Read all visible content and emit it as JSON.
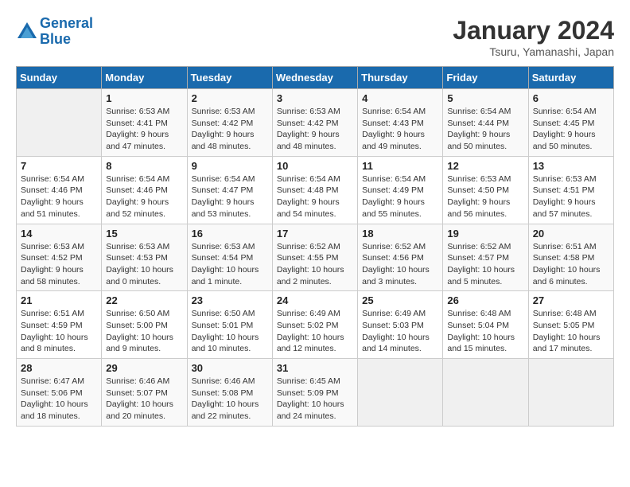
{
  "header": {
    "logo_line1": "General",
    "logo_line2": "Blue",
    "month": "January 2024",
    "location": "Tsuru, Yamanashi, Japan"
  },
  "days_of_week": [
    "Sunday",
    "Monday",
    "Tuesday",
    "Wednesday",
    "Thursday",
    "Friday",
    "Saturday"
  ],
  "weeks": [
    [
      {
        "day": "",
        "sunrise": "",
        "sunset": "",
        "daylight": "",
        "empty": true
      },
      {
        "day": "1",
        "sunrise": "Sunrise: 6:53 AM",
        "sunset": "Sunset: 4:41 PM",
        "daylight": "Daylight: 9 hours and 47 minutes."
      },
      {
        "day": "2",
        "sunrise": "Sunrise: 6:53 AM",
        "sunset": "Sunset: 4:42 PM",
        "daylight": "Daylight: 9 hours and 48 minutes."
      },
      {
        "day": "3",
        "sunrise": "Sunrise: 6:53 AM",
        "sunset": "Sunset: 4:42 PM",
        "daylight": "Daylight: 9 hours and 48 minutes."
      },
      {
        "day": "4",
        "sunrise": "Sunrise: 6:54 AM",
        "sunset": "Sunset: 4:43 PM",
        "daylight": "Daylight: 9 hours and 49 minutes."
      },
      {
        "day": "5",
        "sunrise": "Sunrise: 6:54 AM",
        "sunset": "Sunset: 4:44 PM",
        "daylight": "Daylight: 9 hours and 50 minutes."
      },
      {
        "day": "6",
        "sunrise": "Sunrise: 6:54 AM",
        "sunset": "Sunset: 4:45 PM",
        "daylight": "Daylight: 9 hours and 50 minutes."
      }
    ],
    [
      {
        "day": "7",
        "sunrise": "Sunrise: 6:54 AM",
        "sunset": "Sunset: 4:46 PM",
        "daylight": "Daylight: 9 hours and 51 minutes."
      },
      {
        "day": "8",
        "sunrise": "Sunrise: 6:54 AM",
        "sunset": "Sunset: 4:46 PM",
        "daylight": "Daylight: 9 hours and 52 minutes."
      },
      {
        "day": "9",
        "sunrise": "Sunrise: 6:54 AM",
        "sunset": "Sunset: 4:47 PM",
        "daylight": "Daylight: 9 hours and 53 minutes."
      },
      {
        "day": "10",
        "sunrise": "Sunrise: 6:54 AM",
        "sunset": "Sunset: 4:48 PM",
        "daylight": "Daylight: 9 hours and 54 minutes."
      },
      {
        "day": "11",
        "sunrise": "Sunrise: 6:54 AM",
        "sunset": "Sunset: 4:49 PM",
        "daylight": "Daylight: 9 hours and 55 minutes."
      },
      {
        "day": "12",
        "sunrise": "Sunrise: 6:53 AM",
        "sunset": "Sunset: 4:50 PM",
        "daylight": "Daylight: 9 hours and 56 minutes."
      },
      {
        "day": "13",
        "sunrise": "Sunrise: 6:53 AM",
        "sunset": "Sunset: 4:51 PM",
        "daylight": "Daylight: 9 hours and 57 minutes."
      }
    ],
    [
      {
        "day": "14",
        "sunrise": "Sunrise: 6:53 AM",
        "sunset": "Sunset: 4:52 PM",
        "daylight": "Daylight: 9 hours and 58 minutes."
      },
      {
        "day": "15",
        "sunrise": "Sunrise: 6:53 AM",
        "sunset": "Sunset: 4:53 PM",
        "daylight": "Daylight: 10 hours and 0 minutes."
      },
      {
        "day": "16",
        "sunrise": "Sunrise: 6:53 AM",
        "sunset": "Sunset: 4:54 PM",
        "daylight": "Daylight: 10 hours and 1 minute."
      },
      {
        "day": "17",
        "sunrise": "Sunrise: 6:52 AM",
        "sunset": "Sunset: 4:55 PM",
        "daylight": "Daylight: 10 hours and 2 minutes."
      },
      {
        "day": "18",
        "sunrise": "Sunrise: 6:52 AM",
        "sunset": "Sunset: 4:56 PM",
        "daylight": "Daylight: 10 hours and 3 minutes."
      },
      {
        "day": "19",
        "sunrise": "Sunrise: 6:52 AM",
        "sunset": "Sunset: 4:57 PM",
        "daylight": "Daylight: 10 hours and 5 minutes."
      },
      {
        "day": "20",
        "sunrise": "Sunrise: 6:51 AM",
        "sunset": "Sunset: 4:58 PM",
        "daylight": "Daylight: 10 hours and 6 minutes."
      }
    ],
    [
      {
        "day": "21",
        "sunrise": "Sunrise: 6:51 AM",
        "sunset": "Sunset: 4:59 PM",
        "daylight": "Daylight: 10 hours and 8 minutes."
      },
      {
        "day": "22",
        "sunrise": "Sunrise: 6:50 AM",
        "sunset": "Sunset: 5:00 PM",
        "daylight": "Daylight: 10 hours and 9 minutes."
      },
      {
        "day": "23",
        "sunrise": "Sunrise: 6:50 AM",
        "sunset": "Sunset: 5:01 PM",
        "daylight": "Daylight: 10 hours and 10 minutes."
      },
      {
        "day": "24",
        "sunrise": "Sunrise: 6:49 AM",
        "sunset": "Sunset: 5:02 PM",
        "daylight": "Daylight: 10 hours and 12 minutes."
      },
      {
        "day": "25",
        "sunrise": "Sunrise: 6:49 AM",
        "sunset": "Sunset: 5:03 PM",
        "daylight": "Daylight: 10 hours and 14 minutes."
      },
      {
        "day": "26",
        "sunrise": "Sunrise: 6:48 AM",
        "sunset": "Sunset: 5:04 PM",
        "daylight": "Daylight: 10 hours and 15 minutes."
      },
      {
        "day": "27",
        "sunrise": "Sunrise: 6:48 AM",
        "sunset": "Sunset: 5:05 PM",
        "daylight": "Daylight: 10 hours and 17 minutes."
      }
    ],
    [
      {
        "day": "28",
        "sunrise": "Sunrise: 6:47 AM",
        "sunset": "Sunset: 5:06 PM",
        "daylight": "Daylight: 10 hours and 18 minutes."
      },
      {
        "day": "29",
        "sunrise": "Sunrise: 6:46 AM",
        "sunset": "Sunset: 5:07 PM",
        "daylight": "Daylight: 10 hours and 20 minutes."
      },
      {
        "day": "30",
        "sunrise": "Sunrise: 6:46 AM",
        "sunset": "Sunset: 5:08 PM",
        "daylight": "Daylight: 10 hours and 22 minutes."
      },
      {
        "day": "31",
        "sunrise": "Sunrise: 6:45 AM",
        "sunset": "Sunset: 5:09 PM",
        "daylight": "Daylight: 10 hours and 24 minutes."
      },
      {
        "day": "",
        "sunrise": "",
        "sunset": "",
        "daylight": "",
        "empty": true
      },
      {
        "day": "",
        "sunrise": "",
        "sunset": "",
        "daylight": "",
        "empty": true
      },
      {
        "day": "",
        "sunrise": "",
        "sunset": "",
        "daylight": "",
        "empty": true
      }
    ]
  ]
}
